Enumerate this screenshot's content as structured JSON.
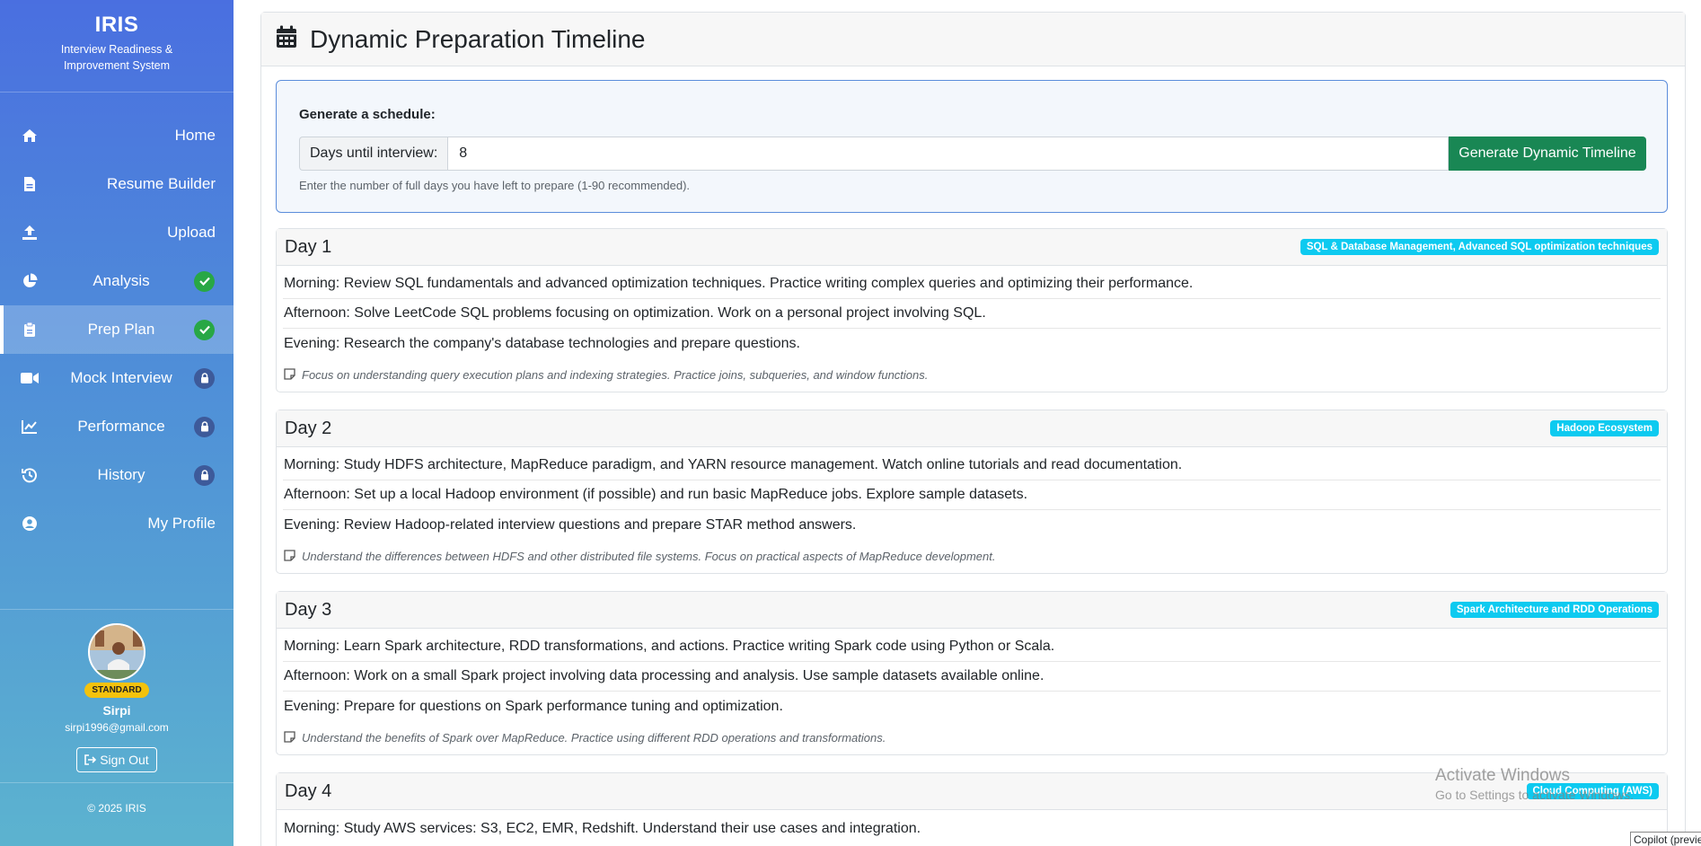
{
  "sidebar": {
    "brand_title": "IRIS",
    "brand_subtitle": "Interview Readiness & Improvement System",
    "items": [
      {
        "label": "Home",
        "icon": "home-icon",
        "status": ""
      },
      {
        "label": "Resume Builder",
        "icon": "file-icon",
        "status": ""
      },
      {
        "label": "Upload",
        "icon": "upload-icon",
        "status": ""
      },
      {
        "label": "Analysis",
        "icon": "pie-chart-icon",
        "status": "completed"
      },
      {
        "label": "Prep Plan",
        "icon": "clipboard-icon",
        "status": "completed",
        "active": true
      },
      {
        "label": "Mock Interview",
        "icon": "video-icon",
        "status": "locked"
      },
      {
        "label": "Performance",
        "icon": "line-chart-icon",
        "status": "locked"
      },
      {
        "label": "History",
        "icon": "history-icon",
        "status": "locked"
      },
      {
        "label": "My Profile",
        "icon": "user-circle-icon",
        "status": ""
      }
    ],
    "profile": {
      "plan": "STANDARD",
      "name": "Sirpi",
      "email": "sirpi1996@gmail.com",
      "signout_label": "Sign Out"
    },
    "copyright": "© 2025 IRIS"
  },
  "main": {
    "title": "Dynamic Preparation Timeline",
    "generator": {
      "heading": "Generate a schedule:",
      "input_label": "Days until interview:",
      "input_value": "8",
      "button_label": "Generate Dynamic Timeline",
      "help_text": "Enter the number of full days you have left to prepare (1-90 recommended)."
    },
    "days": [
      {
        "title": "Day 1",
        "tag": "SQL & Database Management, Advanced SQL optimization techniques",
        "tasks": [
          "Morning: Review SQL fundamentals and advanced optimization techniques. Practice writing complex queries and optimizing their performance.",
          "Afternoon: Solve LeetCode SQL problems focusing on optimization. Work on a personal project involving SQL.",
          "Evening: Research the company's database technologies and prepare questions."
        ],
        "note": "Focus on understanding query execution plans and indexing strategies. Practice joins, subqueries, and window functions."
      },
      {
        "title": "Day 2",
        "tag": "Hadoop Ecosystem",
        "tasks": [
          "Morning: Study HDFS architecture, MapReduce paradigm, and YARN resource management. Watch online tutorials and read documentation.",
          "Afternoon: Set up a local Hadoop environment (if possible) and run basic MapReduce jobs. Explore sample datasets.",
          "Evening: Review Hadoop-related interview questions and prepare STAR method answers."
        ],
        "note": "Understand the differences between HDFS and other distributed file systems. Focus on practical aspects of MapReduce development."
      },
      {
        "title": "Day 3",
        "tag": "Spark Architecture and RDD Operations",
        "tasks": [
          "Morning: Learn Spark architecture, RDD transformations, and actions. Practice writing Spark code using Python or Scala.",
          "Afternoon: Work on a small Spark project involving data processing and analysis. Use sample datasets available online.",
          "Evening: Prepare for questions on Spark performance tuning and optimization."
        ],
        "note": "Understand the benefits of Spark over MapReduce. Practice using different RDD operations and transformations."
      },
      {
        "title": "Day 4",
        "tag": "Cloud Computing (AWS)",
        "tasks": [
          "Morning: Study AWS services: S3, EC2, EMR, Redshift. Understand their use cases and integration."
        ],
        "note": ""
      }
    ]
  },
  "overlay": {
    "watermark_line1": "Activate Windows",
    "watermark_line2": "Go to Settings to activate Windows.",
    "copilot_label": "Copilot (preview)"
  },
  "colors": {
    "accent_green": "#198754",
    "tag_cyan": "#0dcaf0",
    "check_green": "#28a745",
    "plan_badge": "#f4c20d"
  }
}
